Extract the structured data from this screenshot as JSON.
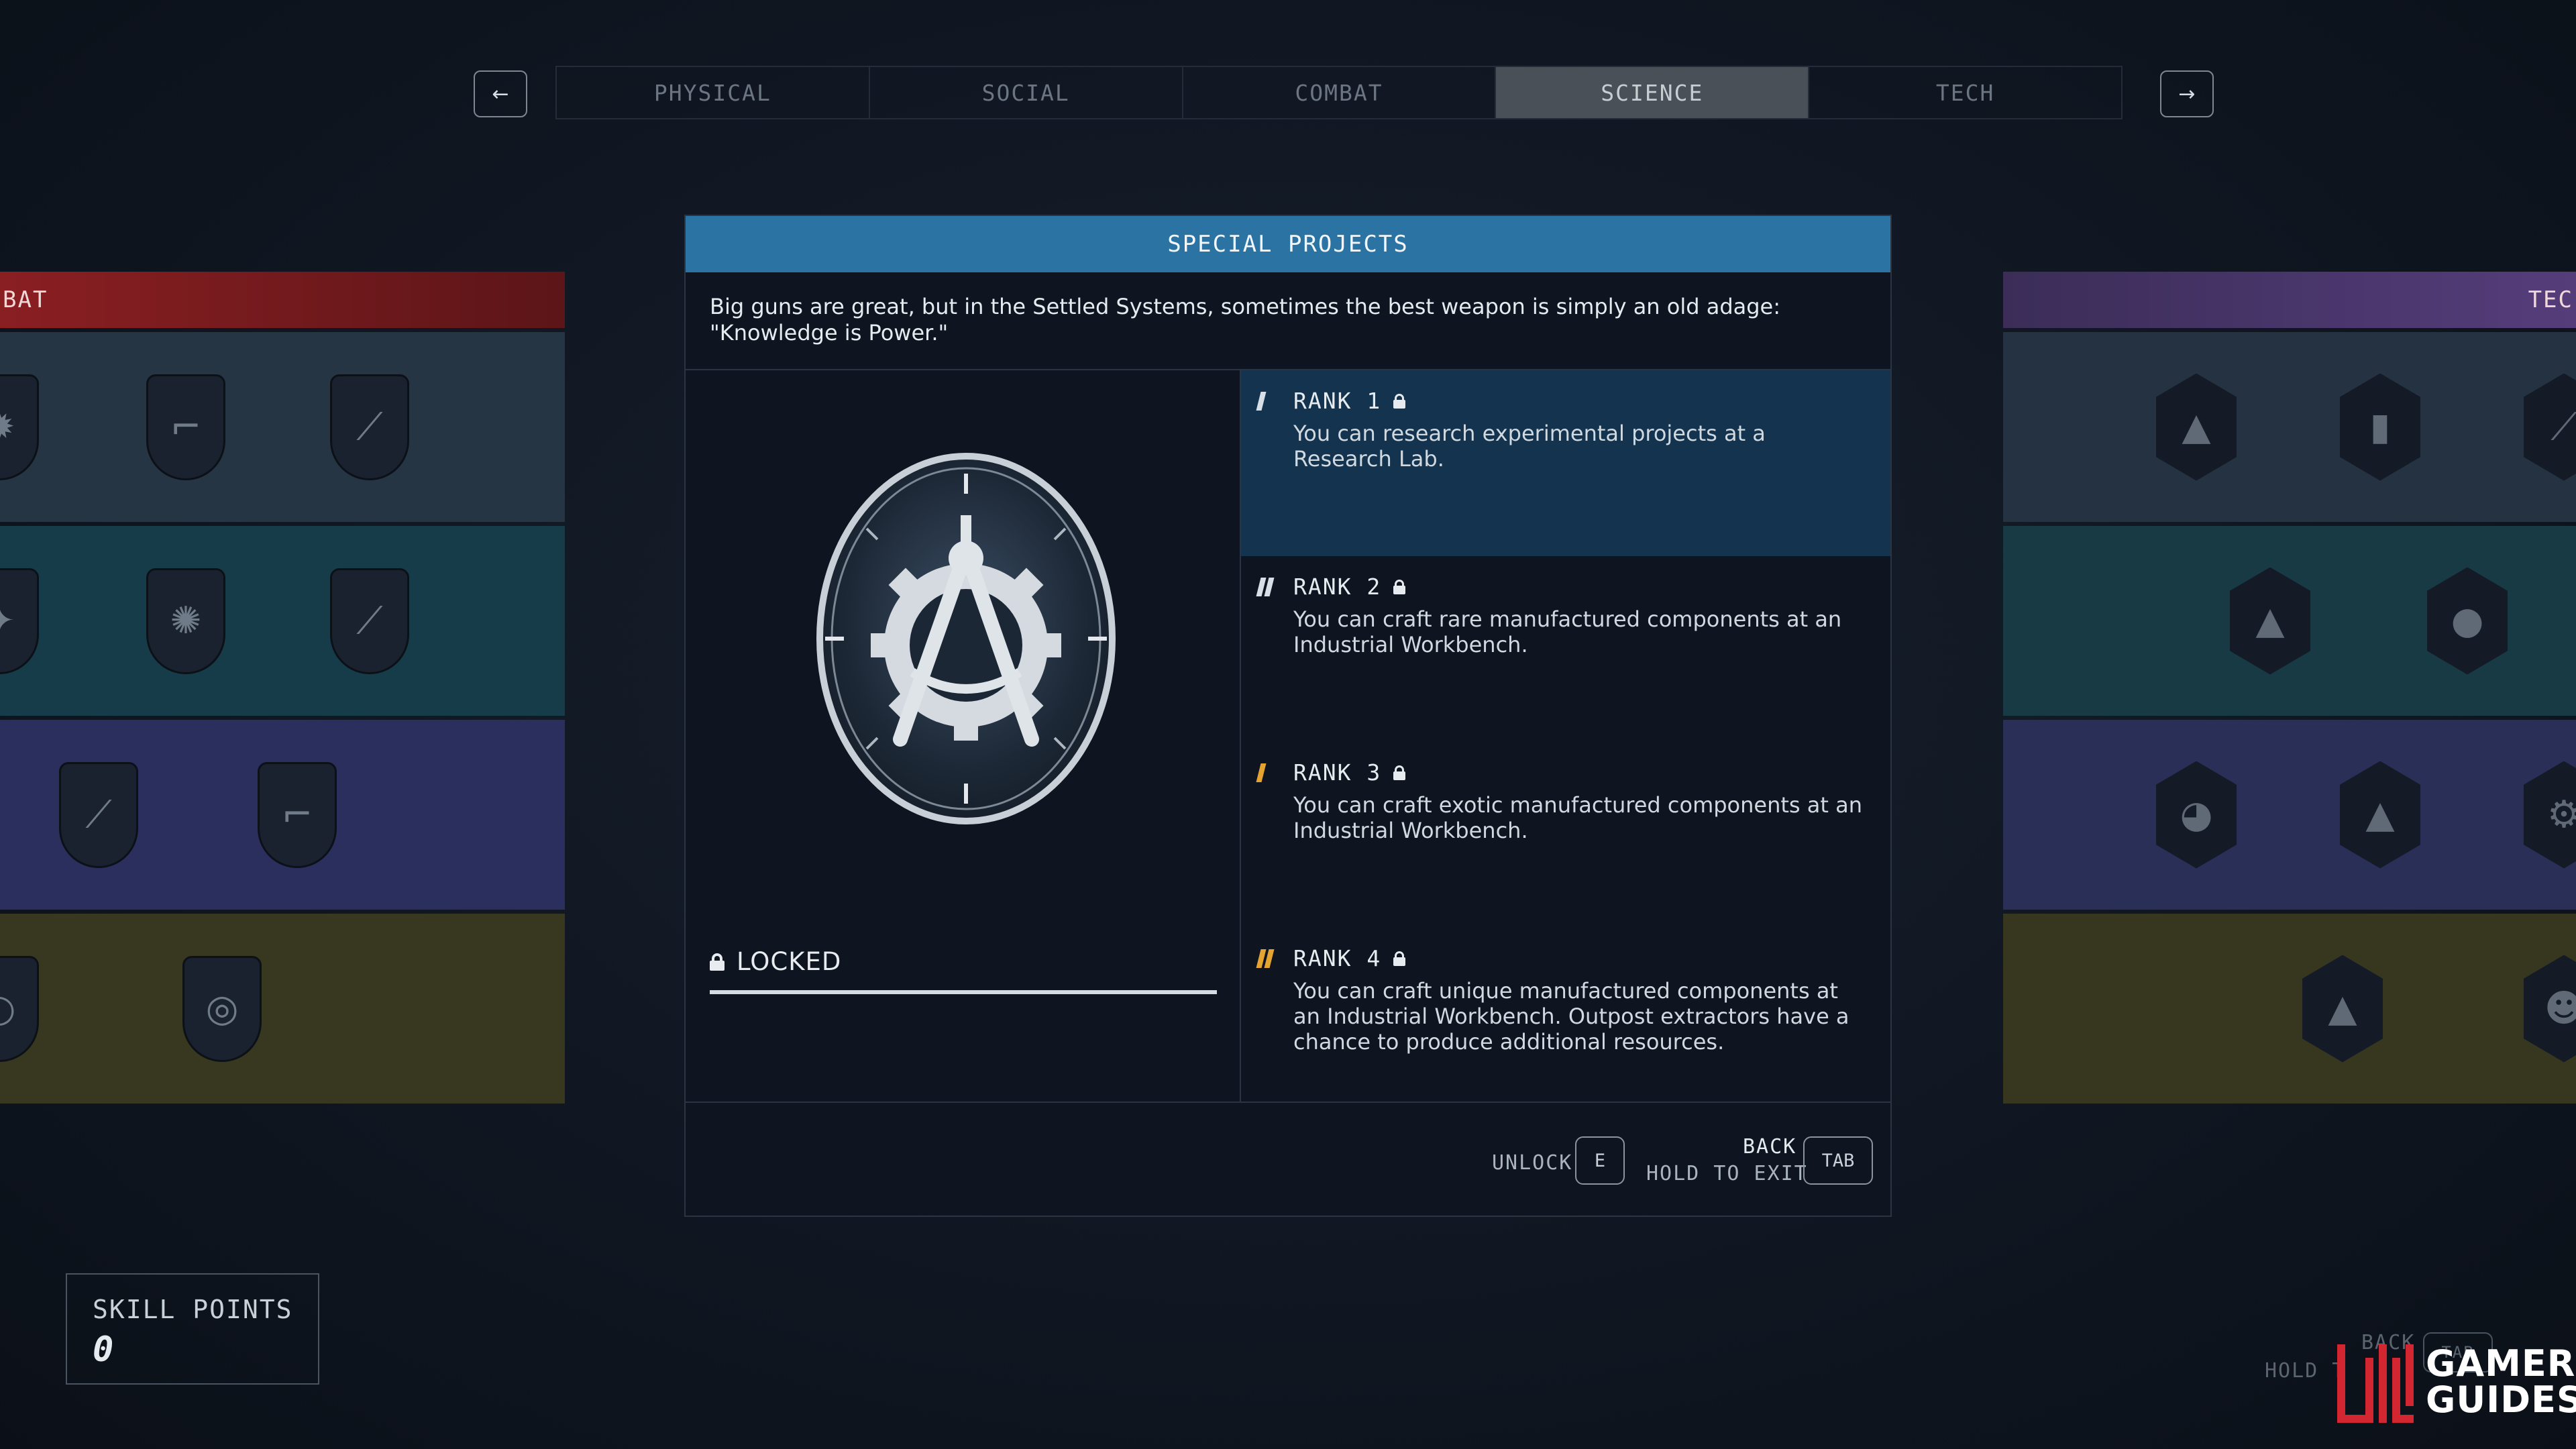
{
  "tabs": {
    "prev_icon": "arrow-left-icon",
    "next_icon": "arrow-right-icon",
    "prev_glyph": "←",
    "next_glyph": "→",
    "items": [
      {
        "label": "PHYSICAL",
        "active": false
      },
      {
        "label": "SOCIAL",
        "active": false
      },
      {
        "label": "COMBAT",
        "active": false
      },
      {
        "label": "SCIENCE",
        "active": true
      },
      {
        "label": "TECH",
        "active": false
      }
    ]
  },
  "left_tree": {
    "header": "BAT",
    "color": "#8a1f22",
    "row_colors": [
      "#263544",
      "#173c49",
      "#2b2f5e",
      "#38371f"
    ]
  },
  "right_tree": {
    "header": "TEC",
    "color": "#553d7a",
    "row_colors": [
      "#243241",
      "#173a45",
      "#2a2f58",
      "#37371f"
    ]
  },
  "panel": {
    "title": "SPECIAL PROJECTS",
    "title_color": "#2a73a3",
    "description": "Big guns are great, but in the Settled Systems, sometimes the best weapon is simply an old adage: \"Knowledge is Power.\"",
    "status": "LOCKED",
    "ranks": [
      {
        "label": "RANK 1",
        "text": "You can research experimental projects at a Research Lab.",
        "active": true
      },
      {
        "label": "RANK 2",
        "text": "You can craft rare manufactured components at an Industrial Workbench.",
        "active": false
      },
      {
        "label": "RANK 3",
        "text": "You can craft exotic manufactured components at an Industrial Workbench.",
        "active": false
      },
      {
        "label": "RANK 4",
        "text": "You can craft unique manufactured components at an Industrial Workbench. Outpost extractors have a chance to produce additional resources.",
        "active": false
      }
    ],
    "footer": {
      "unlock_label": "UNLOCK",
      "unlock_key": "E",
      "back_label": "BACK",
      "exit_label": "HOLD TO EXIT",
      "back_key": "TAB"
    }
  },
  "skill_points": {
    "label": "SKILL POINTS",
    "value": "0"
  },
  "background_hint": {
    "back_label": "BACK",
    "hold_label": "HOLD T",
    "key": "TAB"
  },
  "logo": {
    "line1": "GAMER",
    "line2": "GUIDES",
    "accent": "#d22630"
  }
}
